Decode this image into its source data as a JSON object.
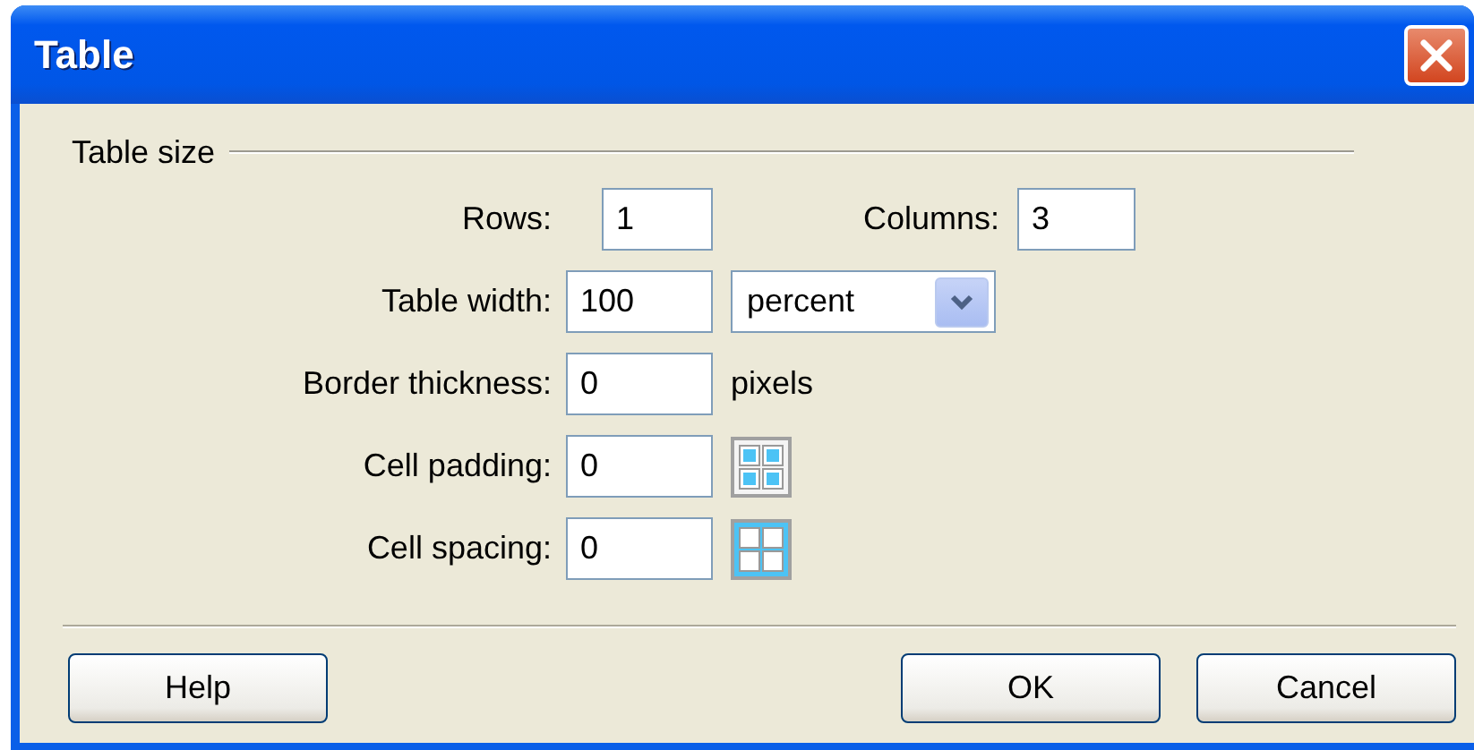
{
  "window": {
    "title": "Table"
  },
  "group": {
    "label": "Table size"
  },
  "rows": [
    {
      "kind": "pair",
      "label": "Rows:",
      "value": "1",
      "label_2": "Columns:",
      "value_2": "3"
    },
    {
      "kind": "select",
      "label": "Table width:",
      "value": "100",
      "option": "percent"
    },
    {
      "kind": "unit",
      "label": "Border thickness:",
      "value": "0",
      "unit": "pixels"
    },
    {
      "kind": "padding",
      "label": "Cell padding:",
      "value": "0"
    },
    {
      "kind": "spacing",
      "label": "Cell spacing:",
      "value": "0"
    }
  ],
  "buttons": [
    {
      "label": "Help",
      "kind": "left"
    },
    {
      "label": "OK",
      "kind": "right"
    },
    {
      "label": "Cancel",
      "kind": "right"
    }
  ]
}
